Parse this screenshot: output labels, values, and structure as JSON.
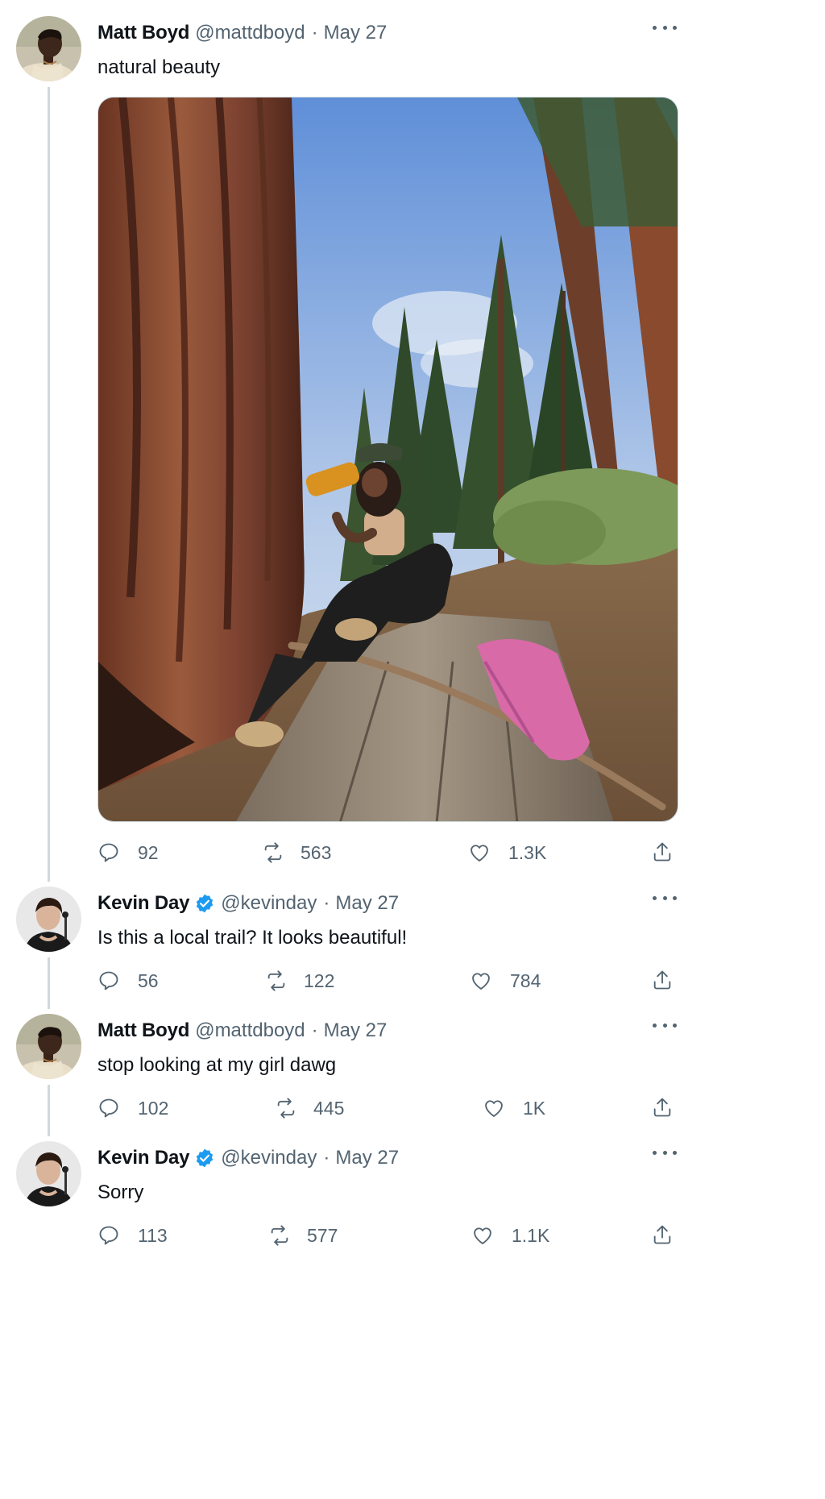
{
  "thread": [
    {
      "name": "Matt Boyd",
      "handle": "@mattdboyd",
      "separator": "·",
      "date": "May 27",
      "verified": false,
      "text": "natural beauty",
      "has_media": true,
      "replies": "92",
      "retweets": "563",
      "likes": "1.3K",
      "avatar_icon": "person-avatar"
    },
    {
      "name": "Kevin Day",
      "handle": "@kevinday",
      "separator": "·",
      "date": "May 27",
      "verified": true,
      "text": "Is this a local trail? It looks beautiful!",
      "has_media": false,
      "replies": "56",
      "retweets": "122",
      "likes": "784",
      "avatar_icon": "person-avatar"
    },
    {
      "name": "Matt Boyd",
      "handle": "@mattdboyd",
      "separator": "·",
      "date": "May 27",
      "verified": false,
      "text": "stop looking at my girl dawg",
      "has_media": false,
      "replies": "102",
      "retweets": "445",
      "likes": "1K",
      "avatar_icon": "person-avatar"
    },
    {
      "name": "Kevin Day",
      "handle": "@kevinday",
      "separator": "·",
      "date": "May 27",
      "verified": true,
      "text": "Sorry",
      "has_media": false,
      "replies": "113",
      "retweets": "577",
      "likes": "1.1K",
      "avatar_icon": "person-avatar"
    }
  ],
  "icons": {
    "reply": "reply-icon",
    "retweet": "retweet-icon",
    "like": "heart-icon",
    "share": "share-icon",
    "more": "more-options-icon",
    "verified": "verified-badge-icon"
  },
  "colors": {
    "text_primary": "#0f1419",
    "text_secondary": "#536471",
    "verified_blue": "#1d9bf0",
    "thread_line": "#cfd9de"
  }
}
